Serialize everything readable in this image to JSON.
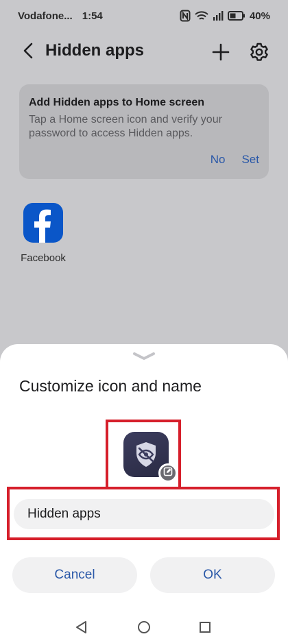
{
  "status_bar": {
    "carrier": "Vodafone...",
    "time": "1:54",
    "battery": "40%",
    "icons": [
      "nfc-icon",
      "wifi-icon",
      "signal-icon",
      "battery-icon"
    ]
  },
  "header": {
    "title": "Hidden apps",
    "icons": [
      "back-arrow-icon",
      "plus-icon",
      "gear-icon"
    ]
  },
  "info_card": {
    "title": "Add Hidden apps to Home screen",
    "description": "Tap a Home screen icon and verify your password to access Hidden apps.",
    "no_label": "No",
    "set_label": "Set"
  },
  "apps": [
    {
      "name": "Facebook",
      "icon": "facebook-icon"
    }
  ],
  "sheet": {
    "title": "Customize icon and name",
    "icon": "hidden-eye-shield-icon",
    "edit_icon": "edit-icon",
    "name_value": "Hidden apps",
    "cancel_label": "Cancel",
    "ok_label": "OK"
  },
  "nav_bar": {
    "icons": [
      "nav-back-icon",
      "nav-home-icon",
      "nav-recents-icon"
    ]
  },
  "colors": {
    "accent": "#2a58a8",
    "highlight": "#d61f2b",
    "facebook": "#0a56c8"
  }
}
